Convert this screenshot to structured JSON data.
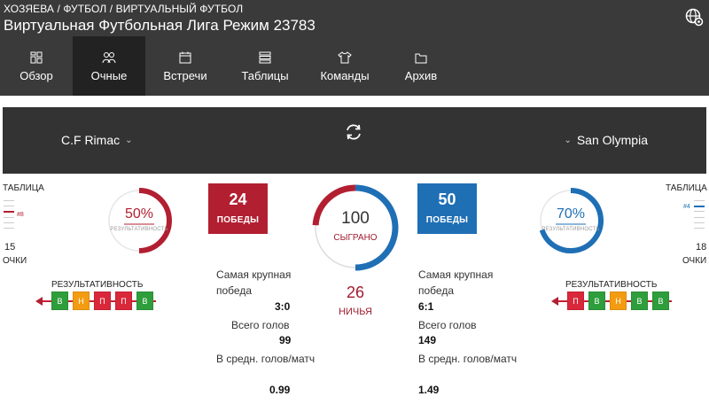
{
  "breadcrumb": "ХОЗЯЕВА / ФУТБОЛ / ВИРТУАЛЬНЫЙ ФУТБОЛ",
  "title": "Виртуальная Футбольная Лига Режим 23783",
  "settings_icon": "gear-globe-icon",
  "tabs": [
    {
      "label": "Обзор",
      "icon": "overview-icon",
      "active": false
    },
    {
      "label": "Очные",
      "icon": "head-to-head-icon",
      "active": true
    },
    {
      "label": "Встречи",
      "icon": "calendar-icon",
      "active": false
    },
    {
      "label": "Таблицы",
      "icon": "table-icon",
      "active": false
    },
    {
      "label": "Команды",
      "icon": "shirt-icon",
      "active": false
    },
    {
      "label": "Архив",
      "icon": "folder-icon",
      "active": false
    }
  ],
  "team_home": {
    "name": "C.F Rimac",
    "table_label": "ТАБЛИЦА",
    "position": "#8",
    "points": "15",
    "points_label": "ОЧКИ",
    "performance_pct": "50%",
    "performance_value": 0.5,
    "performance_label": "РЕЗУЛЬТАТИВНОСТЬ",
    "form_title": "РЕЗУЛЬТАТИВНОСТЬ",
    "form": [
      "В",
      "Н",
      "П",
      "П",
      "В"
    ],
    "wins": "24",
    "wins_label": "ПОБЕДЫ",
    "biggest_win_label": "Самая крупная победа",
    "biggest_win": "3:0",
    "total_goals_label": "Всего голов",
    "total_goals": "99",
    "avg_goals_label": "В средн. голов/матч",
    "avg_goals": "0.99"
  },
  "team_away": {
    "name": "San Olympia",
    "table_label": "ТАБЛИЦА",
    "position": "#4",
    "points": "18",
    "points_label": "ОЧКИ",
    "performance_pct": "70%",
    "performance_value": 0.7,
    "performance_label": "РЕЗУЛЬТАТИВНОСТЬ",
    "form_title": "РЕЗУЛЬТАТИВНОСТЬ",
    "form": [
      "П",
      "В",
      "Н",
      "В",
      "В"
    ],
    "wins": "50",
    "wins_label": "ПОБЕДЫ",
    "biggest_win_label": "Самая крупная победа",
    "biggest_win": "6:1",
    "total_goals_label": "Всего голов",
    "total_goals": "149",
    "avg_goals_label": "В средн. голов/матч",
    "avg_goals": "1.49"
  },
  "matches": {
    "played": "100",
    "played_label": "СЫГРАНО",
    "draws": "26",
    "draws_label": "НИЧЬЯ"
  },
  "colors": {
    "header_bg": "#3a3a3a",
    "team_bar_bg": "#333333",
    "home": "#b21f31",
    "away": "#1f6fb5",
    "win": "#2e9e3c",
    "draw": "#f39c12",
    "loss": "#d9283a"
  }
}
